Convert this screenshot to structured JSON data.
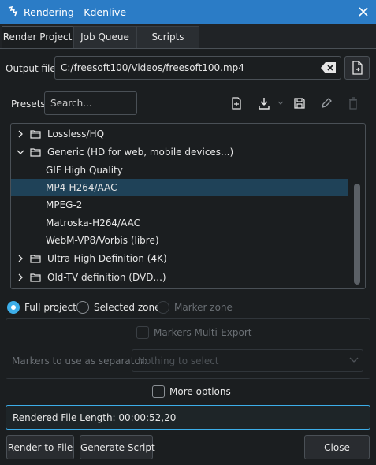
{
  "window": {
    "title": "Rendering - Kdenlive",
    "title_color": "#2b7cc6"
  },
  "tabs": [
    {
      "label": "Render Project",
      "active": true
    },
    {
      "label": "Job Queue",
      "active": false
    },
    {
      "label": "Scripts",
      "active": false
    }
  ],
  "output": {
    "label": "Output file",
    "value": "C:/freesoft100/Videos/freesoft100.mp4"
  },
  "presets": {
    "label": "Presets",
    "search_placeholder": "Search..."
  },
  "tree": {
    "items": [
      {
        "label": "Lossless/HQ",
        "type": "folder",
        "expanded": false
      },
      {
        "label": "Generic (HD for web, mobile devices...)",
        "type": "folder",
        "expanded": true
      },
      {
        "label": "GIF High Quality",
        "type": "preset"
      },
      {
        "label": "MP4-H264/AAC",
        "type": "preset",
        "selected": true
      },
      {
        "label": "MPEG-2",
        "type": "preset"
      },
      {
        "label": "Matroska-H264/AAC",
        "type": "preset"
      },
      {
        "label": "WebM-VP8/Vorbis (libre)",
        "type": "preset"
      },
      {
        "label": "Ultra-High Definition (4K)",
        "type": "folder",
        "expanded": false
      },
      {
        "label": "Old-TV definition (DVD...)",
        "type": "folder",
        "expanded": false
      }
    ]
  },
  "range": {
    "full_project": "Full project",
    "selected_zone": "Selected zone",
    "marker_zone": "Marker zone",
    "selected": "full_project"
  },
  "markers": {
    "multi_export_label": "Markers Multi-Export",
    "separator_label": "Markers to use as separator:",
    "separator_value": "Nothing to select"
  },
  "more_options": {
    "label": "More options",
    "checked": false
  },
  "rendered_length": "Rendered File Length: 00:00:52,20",
  "buttons": {
    "render_to_file": "Render to File",
    "generate_script": "Generate Script",
    "close": "Close"
  },
  "colors": {
    "accent": "#3daee9",
    "selection": "#1f4258",
    "background": "#1b1e20"
  }
}
